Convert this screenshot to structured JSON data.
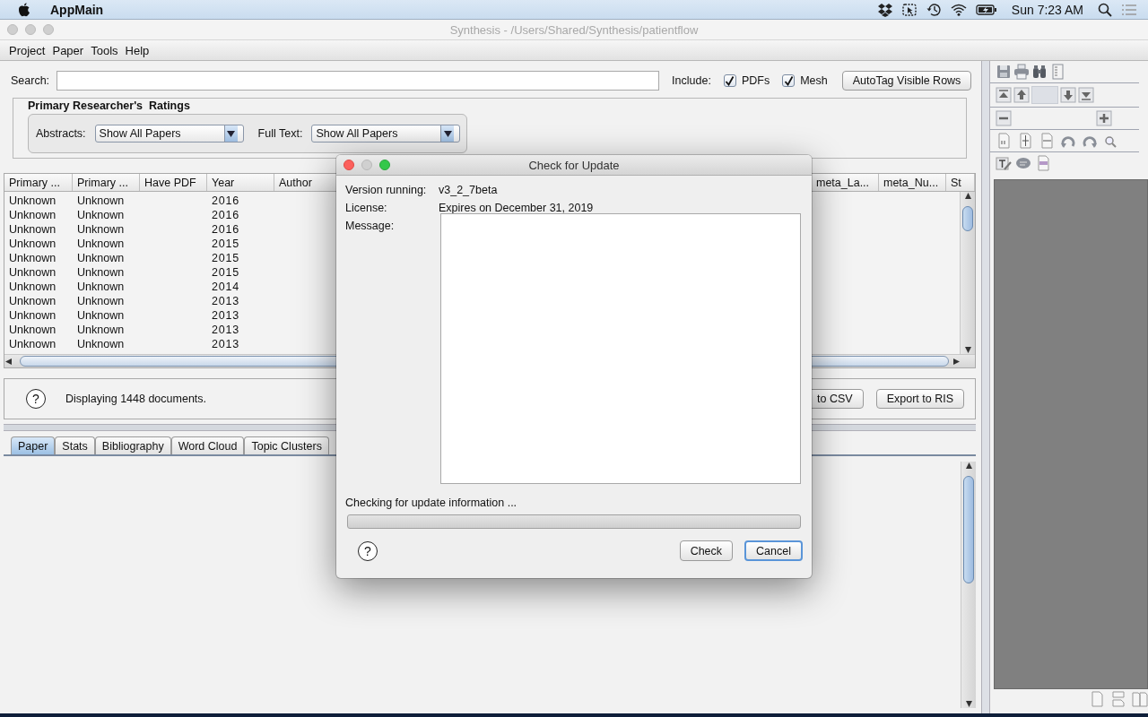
{
  "menubar": {
    "app_name": "AppMain",
    "clock": "Sun 7:23 AM"
  },
  "window": {
    "title": "Synthesis - /Users/Shared/Synthesis/patientflow"
  },
  "menu": [
    "Project",
    "Paper",
    "Tools",
    "Help"
  ],
  "search": {
    "label": "Search:"
  },
  "include": {
    "label": "Include:",
    "options": [
      {
        "label": "PDFs",
        "checked": true
      },
      {
        "label": "Mesh",
        "checked": true
      }
    ]
  },
  "autotag_button": "AutoTag Visible Rows",
  "ratings": {
    "title": "Primary Researcher's  Ratings",
    "filters": [
      {
        "label": "Abstracts:",
        "value": "Show All Papers"
      },
      {
        "label": "Full Text:",
        "value": "Show All Papers"
      }
    ]
  },
  "table": {
    "columns": [
      "Primary ...",
      "Primary ...",
      "Have PDF",
      "Year",
      "Author",
      "meta_La...",
      "meta_Nu...",
      "St"
    ],
    "rows": [
      {
        "primary_1": "Unknown",
        "primary_2": "Unknown",
        "year": "2016"
      },
      {
        "primary_1": "Unknown",
        "primary_2": "Unknown",
        "year": "2016"
      },
      {
        "primary_1": "Unknown",
        "primary_2": "Unknown",
        "year": "2016"
      },
      {
        "primary_1": "Unknown",
        "primary_2": "Unknown",
        "year": "2015"
      },
      {
        "primary_1": "Unknown",
        "primary_2": "Unknown",
        "year": "2015"
      },
      {
        "primary_1": "Unknown",
        "primary_2": "Unknown",
        "year": "2015"
      },
      {
        "primary_1": "Unknown",
        "primary_2": "Unknown",
        "year": "2014"
      },
      {
        "primary_1": "Unknown",
        "primary_2": "Unknown",
        "year": "2013"
      },
      {
        "primary_1": "Unknown",
        "primary_2": "Unknown",
        "year": "2013"
      },
      {
        "primary_1": "Unknown",
        "primary_2": "Unknown",
        "year": "2013"
      },
      {
        "primary_1": "Unknown",
        "primary_2": "Unknown",
        "year": "2013"
      }
    ]
  },
  "status": {
    "help": "?",
    "message": "Displaying 1448 documents.",
    "buttons": [
      "to CSV",
      "Export to RIS"
    ]
  },
  "tabs": [
    {
      "label": "Paper",
      "selected": true
    },
    {
      "label": "Stats",
      "selected": false
    },
    {
      "label": "Bibliography",
      "selected": false
    },
    {
      "label": "Word Cloud",
      "selected": false
    },
    {
      "label": "Topic Clusters",
      "selected": false
    }
  ],
  "dialog": {
    "title": "Check for Update",
    "fields": [
      {
        "label": "Version running:",
        "value": "v3_2_7beta"
      },
      {
        "label": "License:",
        "value": "Expires on December 31, 2019"
      }
    ],
    "message_label": "Message:",
    "status": "Checking for update information ...",
    "progress": {
      "level": 0
    },
    "help": "?",
    "buttons": [
      {
        "label": "Check",
        "default": false
      },
      {
        "label": "Cancel",
        "default": true
      }
    ]
  }
}
